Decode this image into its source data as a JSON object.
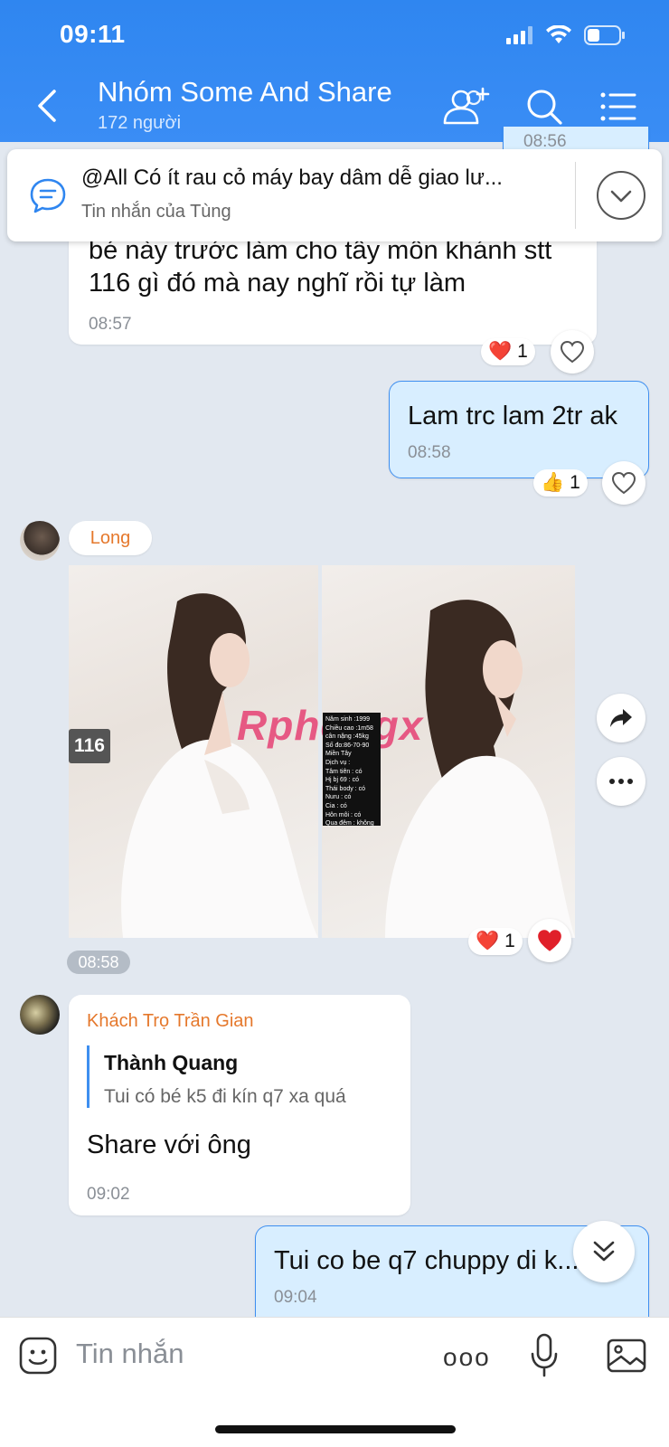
{
  "status": {
    "time": "09:11"
  },
  "header": {
    "title": "Nhóm Some And Share",
    "member_count": "172 người"
  },
  "pinned": {
    "text": "@All  Có ít rau cỏ máy bay dâm dễ giao lư...",
    "subtitle": "Tin nhắn của Tùng"
  },
  "partial_top_time": "08:56",
  "messages": [
    {
      "id": "m1",
      "side": "other",
      "text_line1": "bé này trước làm cho tây môn khánh stt",
      "text_line2": "116 gì đó mà nay nghĩ rồi tự làm",
      "time": "08:57",
      "reaction": "❤️",
      "reaction_count": "1"
    },
    {
      "id": "m2",
      "side": "me",
      "text": "Lam trc lam 2tr ak",
      "time": "08:58",
      "reaction": "👍",
      "reaction_count": "1"
    },
    {
      "id": "m3",
      "side": "other",
      "sender": "Long",
      "type": "image",
      "time": "08:58",
      "reaction": "❤️",
      "reaction_count": "1",
      "image": {
        "watermark": "Rphongx",
        "tag": "116",
        "info_lines": [
          "Năm sinh :1999",
          "Chiều cao :1m58",
          "cân nặng :45kg",
          "Số đo:86-70-90",
          "Miền Tây",
          "Dịch vụ :",
          "Tâm tiên : có",
          "Hj bj 69 : có",
          "Thái body : có",
          "Nuru : có",
          "Cia : có",
          "Hôn môi : có",
          "Qua đêm : không"
        ]
      }
    },
    {
      "id": "m4",
      "side": "other",
      "sender": "Khách Trọ Trần Gian",
      "quote_author": "Thành Quang",
      "quote_text": "Tui có bé k5 đi kín q7 xa quá",
      "text": "Share với ông",
      "time": "09:02"
    },
    {
      "id": "m5",
      "side": "me",
      "text": "Tui co be q7 chuppy di k...",
      "time": "09:04"
    }
  ],
  "input": {
    "placeholder": "Tin nhắn",
    "more_label": "ooo"
  },
  "colors": {
    "header": "#2f86f0",
    "accent": "#3e8ff0",
    "sender": "#e5782c",
    "my_bubble": "#d8eeff",
    "background": "#e2e8f0"
  }
}
